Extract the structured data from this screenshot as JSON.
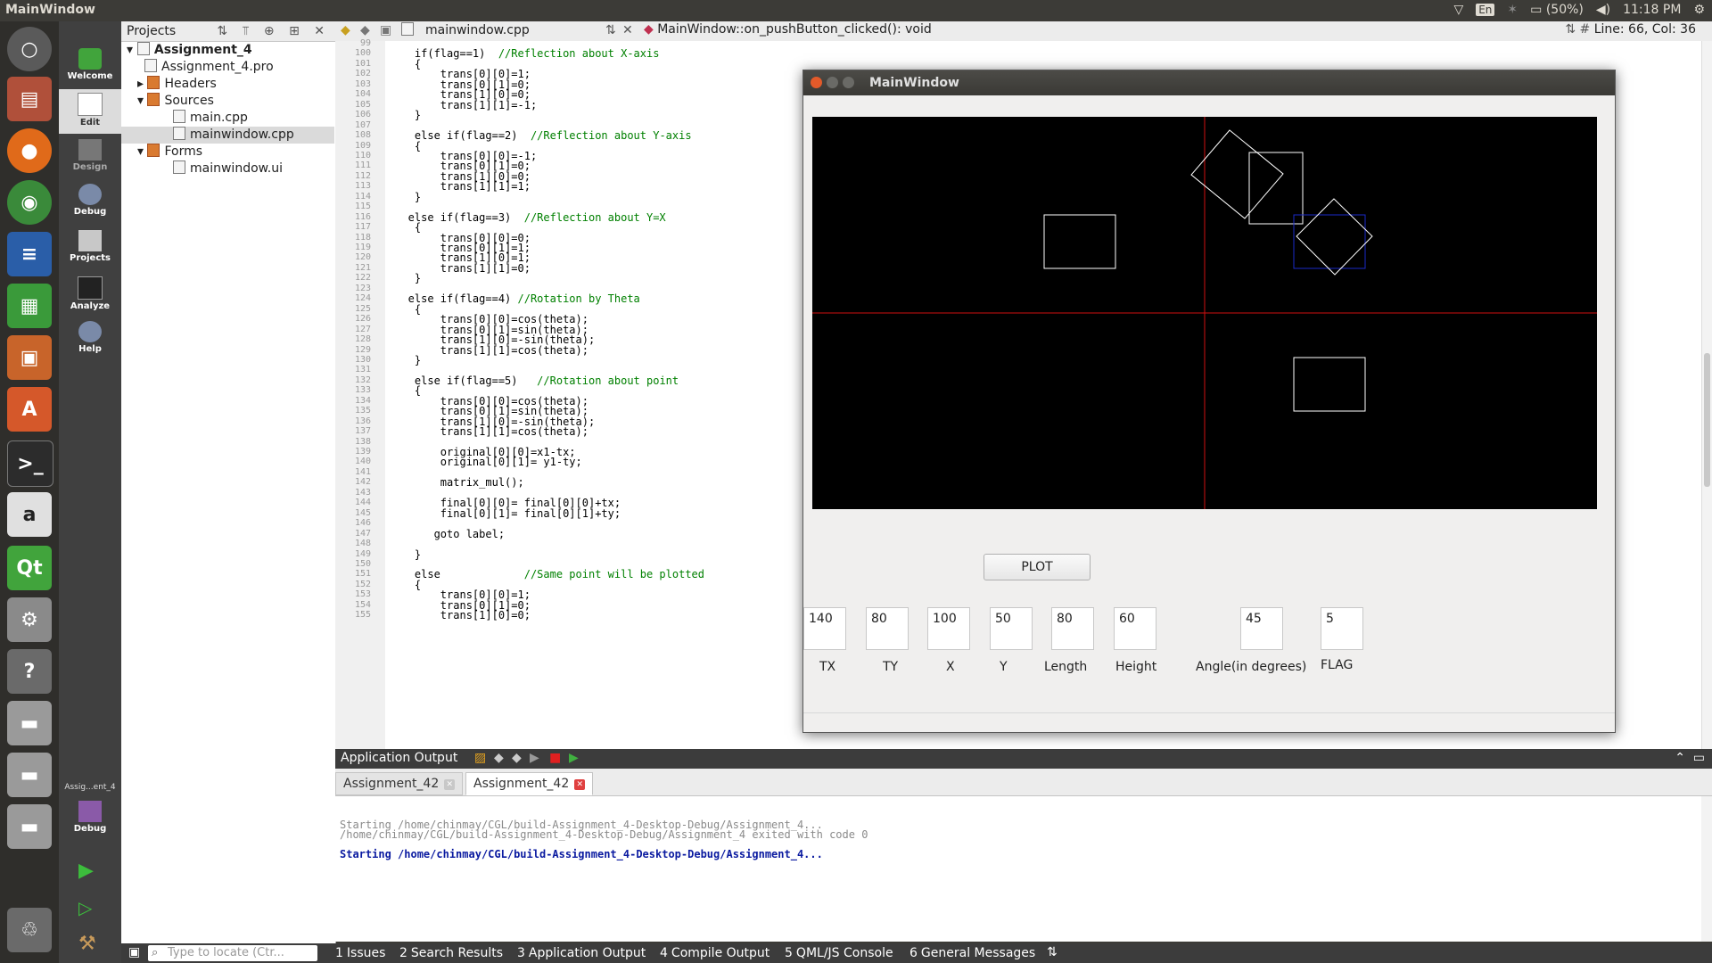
{
  "top_panel": {
    "app_title": "MainWindow",
    "keyboard_lang": "En",
    "battery": "(50%)",
    "clock": "11:18 PM"
  },
  "launcher": {
    "running_label": "Assig...ent_4"
  },
  "modes": [
    {
      "label": "Welcome"
    },
    {
      "label": "Edit"
    },
    {
      "label": "Design"
    },
    {
      "label": "Debug"
    },
    {
      "label": "Projects"
    },
    {
      "label": "Analyze"
    },
    {
      "label": "Help"
    },
    {
      "label": "Debug"
    }
  ],
  "projects": {
    "header": "Projects",
    "tree": [
      {
        "label": "Assignment_4"
      },
      {
        "label": "Assignment_4.pro"
      },
      {
        "label": "Headers"
      },
      {
        "label": "Sources"
      },
      {
        "label": "main.cpp"
      },
      {
        "label": "mainwindow.cpp"
      },
      {
        "label": "Forms"
      },
      {
        "label": "mainwindow.ui"
      }
    ]
  },
  "editor": {
    "file": "mainwindow.cpp",
    "function": "MainWindow::on_pushButton_clicked(): void",
    "position": "Line: 66, Col: 36",
    "line_numbers": [
      "99",
      "100",
      "101",
      "102",
      "103",
      "104",
      "105",
      "106",
      "107",
      "108",
      "109",
      "110",
      "111",
      "112",
      "113",
      "114",
      "115",
      "116",
      "117",
      "118",
      "119",
      "120",
      "121",
      "122",
      "123",
      "124",
      "125",
      "126",
      "127",
      "128",
      "129",
      "130",
      "131",
      "132",
      "133",
      "134",
      "135",
      "136",
      "137",
      "138",
      "139",
      "140",
      "141",
      "142",
      "143",
      "144",
      "145",
      "146",
      "147",
      "148",
      "149",
      "150",
      "151",
      "152",
      "153",
      "154",
      "155"
    ],
    "lines": [
      {
        "t": "",
        "c": ""
      },
      {
        "t": "    if(flag==1)  ",
        "c": "//Reflection about X-axis"
      },
      {
        "t": "    {",
        "c": ""
      },
      {
        "t": "        trans[0][0]=1;",
        "c": ""
      },
      {
        "t": "        trans[0][1]=0;",
        "c": ""
      },
      {
        "t": "        trans[1][0]=0;",
        "c": ""
      },
      {
        "t": "        trans[1][1]=-1;",
        "c": ""
      },
      {
        "t": "    }",
        "c": ""
      },
      {
        "t": "",
        "c": ""
      },
      {
        "t": "    else if(flag==2)  ",
        "c": "//Reflection about Y-axis"
      },
      {
        "t": "    {",
        "c": ""
      },
      {
        "t": "        trans[0][0]=-1;",
        "c": ""
      },
      {
        "t": "        trans[0][1]=0;",
        "c": ""
      },
      {
        "t": "        trans[1][0]=0;",
        "c": ""
      },
      {
        "t": "        trans[1][1]=1;",
        "c": ""
      },
      {
        "t": "    }",
        "c": ""
      },
      {
        "t": "",
        "c": ""
      },
      {
        "t": "   else if(flag==3)  ",
        "c": "//Reflection about Y=X"
      },
      {
        "t": "    {",
        "c": ""
      },
      {
        "t": "        trans[0][0]=0;",
        "c": ""
      },
      {
        "t": "        trans[0][1]=1;",
        "c": ""
      },
      {
        "t": "        trans[1][0]=1;",
        "c": ""
      },
      {
        "t": "        trans[1][1]=0;",
        "c": ""
      },
      {
        "t": "    }",
        "c": ""
      },
      {
        "t": "",
        "c": ""
      },
      {
        "t": "   else if(flag==4) ",
        "c": "//Rotation by Theta"
      },
      {
        "t": "    {",
        "c": ""
      },
      {
        "t": "        trans[0][0]=cos(theta);",
        "c": ""
      },
      {
        "t": "        trans[0][1]=sin(theta);",
        "c": ""
      },
      {
        "t": "        trans[1][0]=-sin(theta);",
        "c": ""
      },
      {
        "t": "        trans[1][1]=cos(theta);",
        "c": ""
      },
      {
        "t": "    }",
        "c": ""
      },
      {
        "t": "",
        "c": ""
      },
      {
        "t": "    else if(flag==5)   ",
        "c": "//Rotation about point"
      },
      {
        "t": "    {",
        "c": ""
      },
      {
        "t": "        trans[0][0]=cos(theta);",
        "c": ""
      },
      {
        "t": "        trans[0][1]=sin(theta);",
        "c": ""
      },
      {
        "t": "        trans[1][0]=-sin(theta);",
        "c": ""
      },
      {
        "t": "        trans[1][1]=cos(theta);",
        "c": ""
      },
      {
        "t": "",
        "c": ""
      },
      {
        "t": "        original[0][0]=x1-tx;",
        "c": ""
      },
      {
        "t": "        original[0][1]= y1-ty;",
        "c": ""
      },
      {
        "t": "",
        "c": ""
      },
      {
        "t": "        matrix_mul();",
        "c": ""
      },
      {
        "t": "",
        "c": ""
      },
      {
        "t": "        final[0][0]= final[0][0]+tx;",
        "c": ""
      },
      {
        "t": "        final[0][1]= final[0][1]+ty;",
        "c": ""
      },
      {
        "t": "",
        "c": ""
      },
      {
        "t": "       goto label;",
        "c": ""
      },
      {
        "t": "",
        "c": ""
      },
      {
        "t": "    }",
        "c": ""
      },
      {
        "t": "",
        "c": ""
      },
      {
        "t": "    else             ",
        "c": "//Same point will be plotted"
      },
      {
        "t": "    {",
        "c": ""
      },
      {
        "t": "        trans[0][0]=1;",
        "c": ""
      },
      {
        "t": "        trans[0][1]=0;",
        "c": ""
      },
      {
        "t": "        trans[1][0]=0;",
        "c": ""
      }
    ]
  },
  "app_window": {
    "title": "MainWindow",
    "plot_label": "PLOT",
    "fields": [
      {
        "value": "140",
        "label": "TX"
      },
      {
        "value": "80",
        "label": "TY"
      },
      {
        "value": "100",
        "label": "X"
      },
      {
        "value": "50",
        "label": "Y"
      },
      {
        "value": "80",
        "label": "Length"
      },
      {
        "value": "60",
        "label": "Height"
      },
      {
        "value": "45",
        "label": "Angle(in degrees)"
      },
      {
        "value": "5",
        "label": "FLAG"
      }
    ]
  },
  "output": {
    "title": "Application Output",
    "tabs": [
      "Assignment_42",
      "Assignment_42"
    ],
    "lines": [
      {
        "text": "Starting /home/chinmay/CGL/build-Assignment_4-Desktop-Debug/Assignment_4...",
        "style": "gray"
      },
      {
        "text": "/home/chinmay/CGL/build-Assignment_4-Desktop-Debug/Assignment_4 exited with code 0",
        "style": "gray"
      },
      {
        "text": "",
        "style": "gray"
      },
      {
        "text": "Starting /home/chinmay/CGL/build-Assignment_4-Desktop-Debug/Assignment_4...",
        "style": "blue"
      }
    ]
  },
  "statusbar": {
    "locate_placeholder": "Type to locate (Ctr...",
    "tabs": [
      {
        "num": "1",
        "label": "Issues"
      },
      {
        "num": "2",
        "label": "Search Results"
      },
      {
        "num": "3",
        "label": "Application Output"
      },
      {
        "num": "4",
        "label": "Compile Output"
      },
      {
        "num": "5",
        "label": "QML/JS Console"
      },
      {
        "num": "6",
        "label": "General Messages"
      }
    ]
  }
}
